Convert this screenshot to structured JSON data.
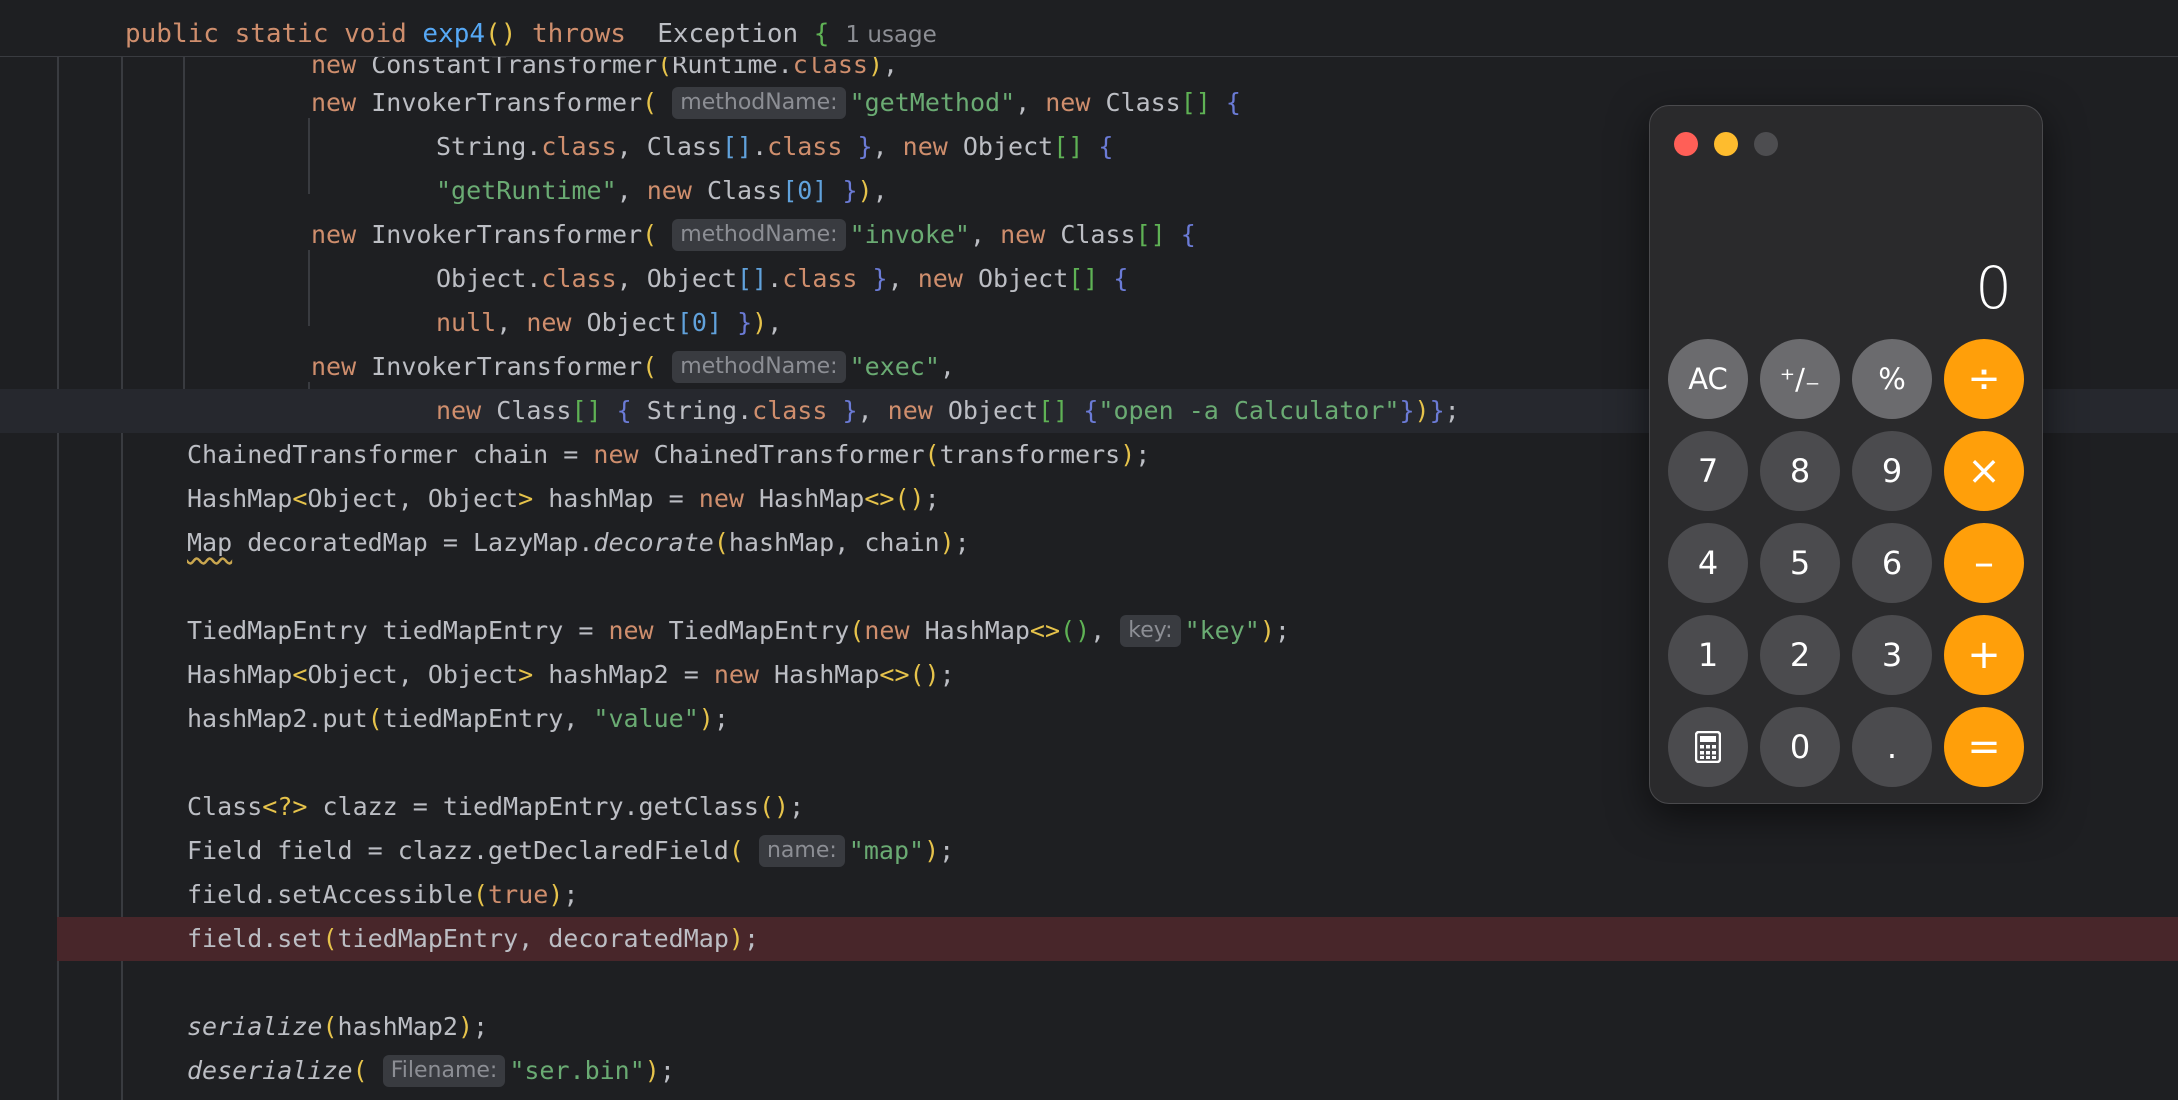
{
  "editor": {
    "signature": {
      "modifiers": "public static void",
      "method_name": "exp4",
      "parens": "()",
      "throws_kw": "throws",
      "exception": "Exception",
      "brace": "{",
      "usage": "1 usage"
    },
    "partial_line": "new ConstantTransformer(Runtime.class),",
    "hints": {
      "method_name": "methodName:",
      "key": "key:",
      "name": "name:",
      "filename": "Filename:"
    },
    "strings": {
      "get_method": "\"getMethod\"",
      "get_runtime": "\"getRuntime\"",
      "invoke": "\"invoke\"",
      "exec": "\"exec\"",
      "open_calc": "\"open -a Calculator\"",
      "key": "\"key\"",
      "value": "\"value\"",
      "map": "\"map\"",
      "ser_bin": "\"ser.bin\""
    }
  },
  "calculator": {
    "display": "0",
    "keys": {
      "ac": "AC",
      "plus_minus": "⁺∕₋",
      "percent": "%",
      "divide": "÷",
      "seven": "7",
      "eight": "8",
      "nine": "9",
      "multiply": "×",
      "four": "4",
      "five": "5",
      "six": "6",
      "minus": "–",
      "one": "1",
      "two": "2",
      "three": "3",
      "plus": "+",
      "calc_icon": "calculator-icon",
      "zero": "0",
      "decimal": ".",
      "equals": "="
    },
    "colors": {
      "operator": "#ff9f0a",
      "function": "#6b6b6e",
      "number": "#4b4b4e",
      "close": "#ff5f57",
      "minimize": "#febc2e",
      "zoom": "#4d4d50"
    }
  }
}
